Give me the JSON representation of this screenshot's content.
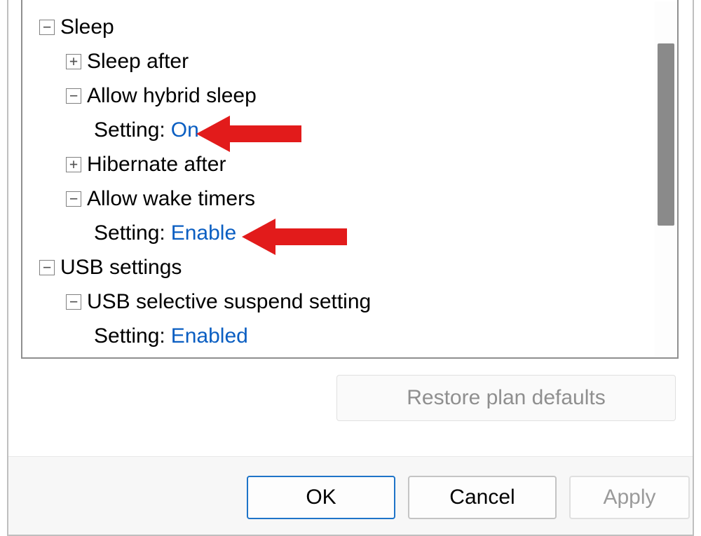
{
  "tree": {
    "sleep": {
      "label": "Sleep",
      "sleep_after": {
        "label": "Sleep after"
      },
      "allow_hybrid_sleep": {
        "label": "Allow hybrid sleep",
        "setting_prefix": "Setting:",
        "setting_value": "On"
      },
      "hibernate_after": {
        "label": "Hibernate after"
      },
      "allow_wake_timers": {
        "label": "Allow wake timers",
        "setting_prefix": "Setting:",
        "setting_value": "Enable"
      }
    },
    "usb_settings": {
      "label": "USB settings",
      "usb_selective_suspend": {
        "label": "USB selective suspend setting",
        "setting_prefix": "Setting:",
        "setting_value": "Enabled"
      }
    }
  },
  "expander": {
    "plus": "+",
    "minus": "−"
  },
  "restore_defaults": "Restore plan defaults",
  "buttons": {
    "ok": "OK",
    "cancel": "Cancel",
    "apply": "Apply"
  },
  "colors": {
    "link": "#0a5ec2",
    "arrow": "#e21b1b"
  }
}
